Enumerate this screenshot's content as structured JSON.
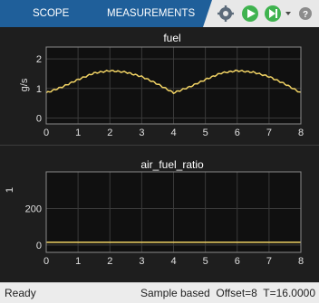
{
  "toolstrip": {
    "tabs": [
      "SCOPE",
      "MEASUREMENTS"
    ],
    "active_tab": "MEASUREMENTS",
    "icons": [
      "tab-arrow-icon",
      "settings-icon",
      "run-icon",
      "step-forward-icon",
      "dropdown-icon",
      "help-icon"
    ],
    "colors": {
      "background": "#1f5f9a",
      "run_button": "#3fb34f"
    }
  },
  "plots": [
    {
      "title": "fuel",
      "ylabel": "g/s",
      "x_ticks": [
        "0",
        "1",
        "2",
        "3",
        "4",
        "5",
        "6",
        "7",
        "8"
      ],
      "y_ticks": [
        "0",
        "1",
        "2"
      ],
      "xlim": [
        0,
        8
      ],
      "ylim": [
        -0.2,
        2.4
      ]
    },
    {
      "title": "air_fuel_ratio",
      "ylabel": "1",
      "x_ticks": [
        "0",
        "1",
        "2",
        "3",
        "4",
        "5",
        "6",
        "7",
        "8"
      ],
      "y_ticks": [
        "0",
        "200"
      ],
      "xlim": [
        0,
        8
      ],
      "ylim": [
        -40,
        400
      ]
    }
  ],
  "chart_data": [
    {
      "type": "line",
      "title": "fuel",
      "xlabel": "",
      "ylabel": "g/s",
      "xlim": [
        0,
        8
      ],
      "ylim": [
        -0.2,
        2.4
      ],
      "grid": true,
      "series": [
        {
          "color": "#f0d264",
          "x": [
            0,
            0.5,
            1,
            1.5,
            2,
            2.5,
            3,
            3.5,
            4,
            4.5,
            5,
            5.5,
            6,
            6.5,
            7,
            7.5,
            8
          ],
          "y": [
            0.85,
            1.05,
            1.3,
            1.52,
            1.6,
            1.55,
            1.4,
            1.15,
            0.85,
            1.05,
            1.3,
            1.52,
            1.6,
            1.55,
            1.4,
            1.15,
            0.85
          ]
        }
      ]
    },
    {
      "type": "line",
      "title": "air_fuel_ratio",
      "xlabel": "",
      "ylabel": "1",
      "xlim": [
        0,
        8
      ],
      "ylim": [
        -40,
        400
      ],
      "grid": true,
      "series": [
        {
          "color": "#f0d264",
          "x": [
            0,
            8
          ],
          "y": [
            14.7,
            14.7
          ]
        }
      ]
    }
  ],
  "status": {
    "left": "Ready",
    "right": "Sample based  Offset=8  T=16.0000"
  }
}
